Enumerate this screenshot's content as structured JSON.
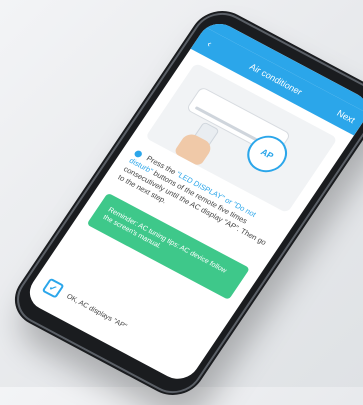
{
  "header": {
    "title": "Air conditioner",
    "next_label": "Next",
    "back_icon": "chevron-left-icon"
  },
  "illustration": {
    "badge_label": "AP"
  },
  "instruction": {
    "prefix": "Press the",
    "button_name": "\"LED DISPLAY\" or \"Do not disturb\"",
    "middle": "buttons of the remote five times consecutively until the AC display \"AP\". Then go to the next step."
  },
  "notice": {
    "text": "Reminder: AC tuning tips: AC device follow the screen's manual."
  },
  "confirm": {
    "checkbox_icon": "check-icon",
    "label": "OK, AC displays \"AP\""
  }
}
